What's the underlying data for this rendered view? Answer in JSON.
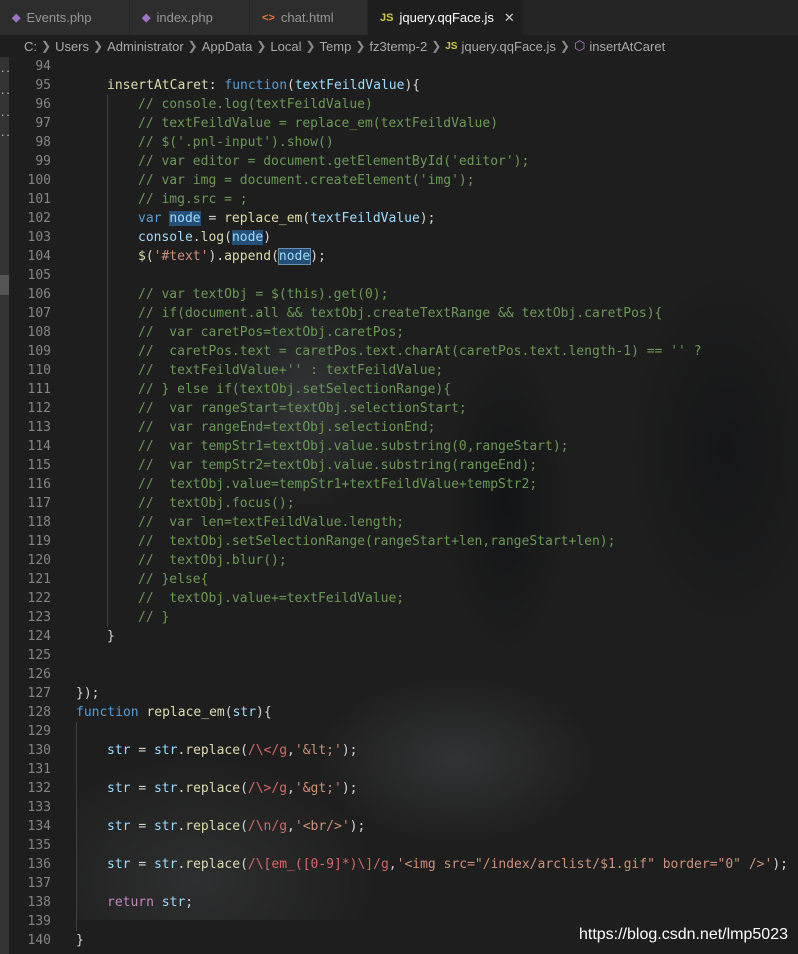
{
  "tabs": [
    {
      "label": "Events.php",
      "icon": "php-elephant-icon",
      "active": false
    },
    {
      "label": "index.php",
      "icon": "php-elephant-icon",
      "active": false
    },
    {
      "label": "chat.html",
      "icon": "html-code-icon",
      "active": false
    },
    {
      "label": "jquery.qqFace.js",
      "icon": "js-file-icon",
      "active": true,
      "close": "✕"
    }
  ],
  "breadcrumb": [
    "C:",
    "Users",
    "Administrator",
    "AppData",
    "Local",
    "Temp",
    "fz3temp-2",
    "jquery.qqFace.js",
    "insertAtCaret"
  ],
  "watermark": "https://blog.csdn.net/lmp5023",
  "lines": [
    {
      "n": "94",
      "t": ""
    },
    {
      "n": "95",
      "t": "insertAtCaret: function(textFeildValue){"
    },
    {
      "n": "96",
      "t": "// console.log(textFeildValue)"
    },
    {
      "n": "97",
      "t": "// textFeildValue = replace_em(textFeildValue)"
    },
    {
      "n": "98",
      "t": "// $('.pnl-input').show()"
    },
    {
      "n": "99",
      "t": "// var editor = document.getElementById('editor');"
    },
    {
      "n": "100",
      "t": "// var img = document.createElement('img');"
    },
    {
      "n": "101",
      "t": "// img.src = ;"
    },
    {
      "n": "102",
      "t": "var node = replace_em(textFeildValue);"
    },
    {
      "n": "103",
      "t": "console.log(node)"
    },
    {
      "n": "104",
      "t": "$('#text').append(node);"
    },
    {
      "n": "105",
      "t": ""
    },
    {
      "n": "106",
      "t": "// var textObj = $(this).get(0);"
    },
    {
      "n": "107",
      "t": "// if(document.all && textObj.createTextRange && textObj.caretPos){"
    },
    {
      "n": "108",
      "t": "//  var caretPos=textObj.caretPos;"
    },
    {
      "n": "109",
      "t": "//  caretPos.text = caretPos.text.charAt(caretPos.text.length-1) == '' ?"
    },
    {
      "n": "110",
      "t": "//  textFeildValue+'' : textFeildValue;"
    },
    {
      "n": "111",
      "t": "// } else if(textObj.setSelectionRange){"
    },
    {
      "n": "112",
      "t": "//  var rangeStart=textObj.selectionStart;"
    },
    {
      "n": "113",
      "t": "//  var rangeEnd=textObj.selectionEnd;"
    },
    {
      "n": "114",
      "t": "//  var tempStr1=textObj.value.substring(0,rangeStart);"
    },
    {
      "n": "115",
      "t": "//  var tempStr2=textObj.value.substring(rangeEnd);"
    },
    {
      "n": "116",
      "t": "//  textObj.value=tempStr1+textFeildValue+tempStr2;"
    },
    {
      "n": "117",
      "t": "//  textObj.focus();"
    },
    {
      "n": "118",
      "t": "//  var len=textFeildValue.length;"
    },
    {
      "n": "119",
      "t": "//  textObj.setSelectionRange(rangeStart+len,rangeStart+len);"
    },
    {
      "n": "120",
      "t": "//  textObj.blur();"
    },
    {
      "n": "121",
      "t": "// }else{"
    },
    {
      "n": "122",
      "t": "//  textObj.value+=textFeildValue;"
    },
    {
      "n": "123",
      "t": "// }"
    },
    {
      "n": "124",
      "t": "}"
    },
    {
      "n": "125",
      "t": ""
    },
    {
      "n": "126",
      "t": ""
    },
    {
      "n": "127",
      "t": "});"
    },
    {
      "n": "128",
      "t": "function replace_em(str){"
    },
    {
      "n": "129",
      "t": ""
    },
    {
      "n": "130",
      "t": "str = str.replace(/\\</g,'&lt;');"
    },
    {
      "n": "131",
      "t": ""
    },
    {
      "n": "132",
      "t": "str = str.replace(/\\>/g,'&gt;');"
    },
    {
      "n": "133",
      "t": ""
    },
    {
      "n": "134",
      "t": "str = str.replace(/\\n/g,'<br/>');"
    },
    {
      "n": "135",
      "t": ""
    },
    {
      "n": "136",
      "t": "str = str.replace(/\\[em_([0-9]*)\\]/g,'<img src=\"/index/arclist/$1.gif\" border=\"0\" />');"
    },
    {
      "n": "137",
      "t": ""
    },
    {
      "n": "138",
      "t": "return str;"
    },
    {
      "n": "139",
      "t": ""
    },
    {
      "n": "140",
      "t": "}"
    }
  ]
}
